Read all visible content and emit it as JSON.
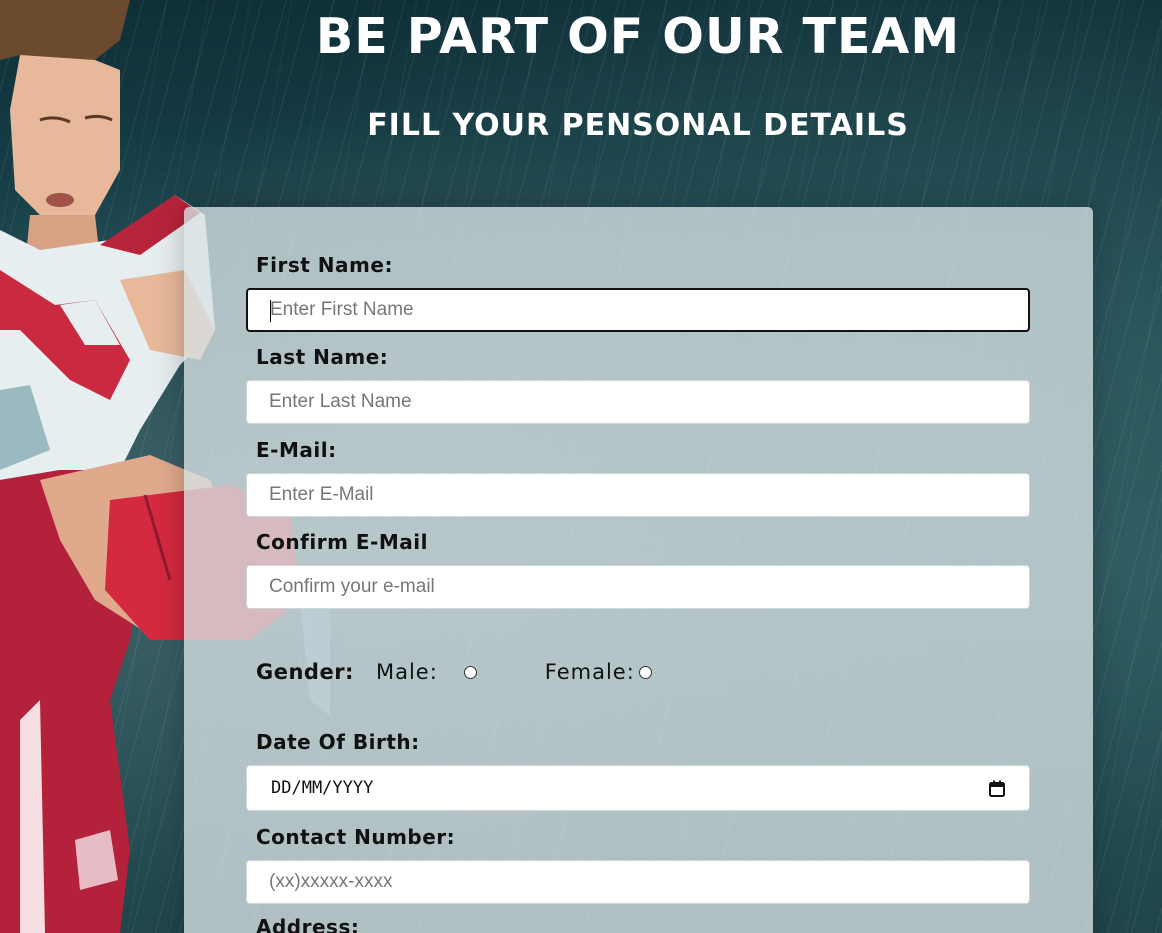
{
  "header": {
    "title": "BE PART OF OUR TEAM",
    "subtitle": "FILL YOUR PENSONAL DETAILS"
  },
  "form": {
    "first_name": {
      "label": "First Name:",
      "placeholder": "Enter First Name",
      "value": ""
    },
    "last_name": {
      "label": "Last Name:",
      "placeholder": "Enter Last Name",
      "value": ""
    },
    "email": {
      "label": "E-Mail:",
      "placeholder": "Enter E-Mail",
      "value": ""
    },
    "confirm_email": {
      "label": "Confirm E-Mail",
      "placeholder": "Confirm your e-mail",
      "value": ""
    },
    "gender": {
      "label": "Gender:",
      "options": [
        "Male:",
        "Female:"
      ],
      "selected": null
    },
    "dob": {
      "label": "Date Of Birth:",
      "placeholder": "DD/MM/YYYY",
      "icon": "calendar-icon"
    },
    "contact": {
      "label": "Contact Number:",
      "placeholder": "(xx)xxxxx-xxxx",
      "value": ""
    },
    "address": {
      "label": "Address:"
    }
  },
  "colors": {
    "panel": "#d7e1e4",
    "background": "#1c4a52",
    "text": "#111111",
    "heading": "#ffffff"
  }
}
